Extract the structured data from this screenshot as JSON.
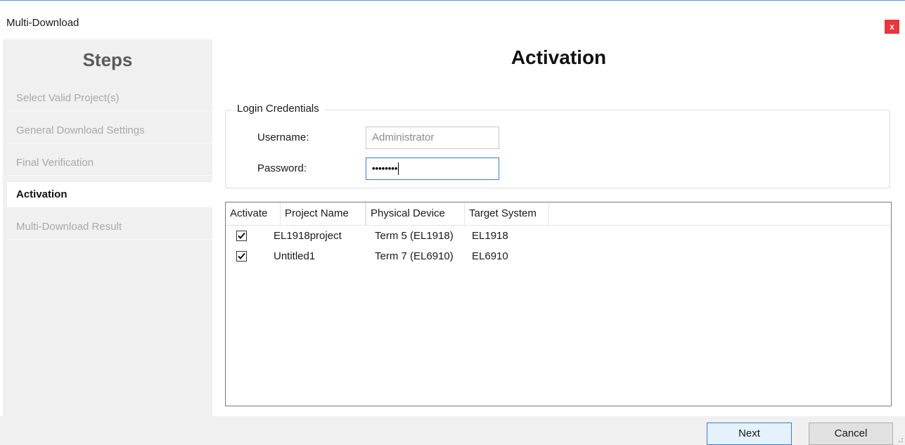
{
  "window": {
    "title": "Multi-Download",
    "close_label": "x"
  },
  "sidebar": {
    "title": "Steps",
    "steps": [
      {
        "label": "Select Valid Project(s)",
        "active": false
      },
      {
        "label": "General Download Settings",
        "active": false
      },
      {
        "label": "Final Verification",
        "active": false
      },
      {
        "label": "Activation",
        "active": true
      },
      {
        "label": "Multi-Download Result",
        "active": false
      }
    ]
  },
  "main": {
    "title": "Activation",
    "credentials": {
      "legend": "Login Credentials",
      "username_label": "Username:",
      "username_value": "Administrator",
      "password_label": "Password:",
      "password_value": "••••••••"
    },
    "table": {
      "columns": [
        "Activate",
        "Project Name",
        "Physical Device",
        "Target System"
      ],
      "rows": [
        {
          "checked": true,
          "project": "EL1918project",
          "device": "Term 5 (EL1918)",
          "target": "EL1918"
        },
        {
          "checked": true,
          "project": "Untitled1",
          "device": "Term 7 (EL6910)",
          "target": "EL6910"
        }
      ]
    }
  },
  "footer": {
    "next_label": "Next",
    "cancel_label": "Cancel"
  },
  "colors": {
    "accent": "#3c7fc1",
    "close": "#e8353a",
    "sidebar_bg": "#f0f0f0"
  }
}
